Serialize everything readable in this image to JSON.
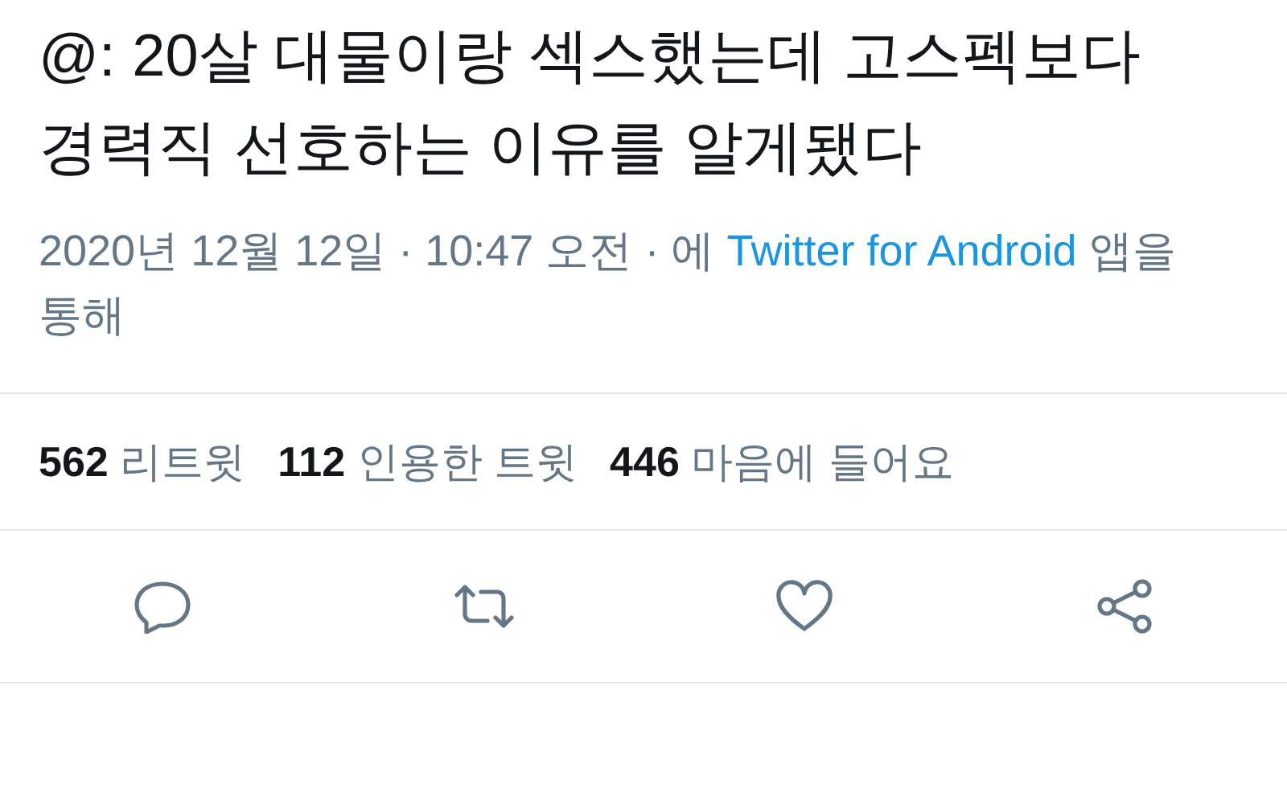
{
  "tweet": {
    "text": "@: 20살 대물이랑 섹스했는데 고스펙보다 경력직 선호하는 이유를 알게됐다"
  },
  "meta": {
    "before": "2020년 12월 12일 · 10:47 오전 · 에 ",
    "link": "Twitter for Android",
    "after": " 앱을 통해"
  },
  "stats": [
    {
      "count": "562",
      "label": "리트윗"
    },
    {
      "count": "112",
      "label": "인용한 트윗"
    },
    {
      "count": "446",
      "label": "마음에 들어요"
    }
  ]
}
